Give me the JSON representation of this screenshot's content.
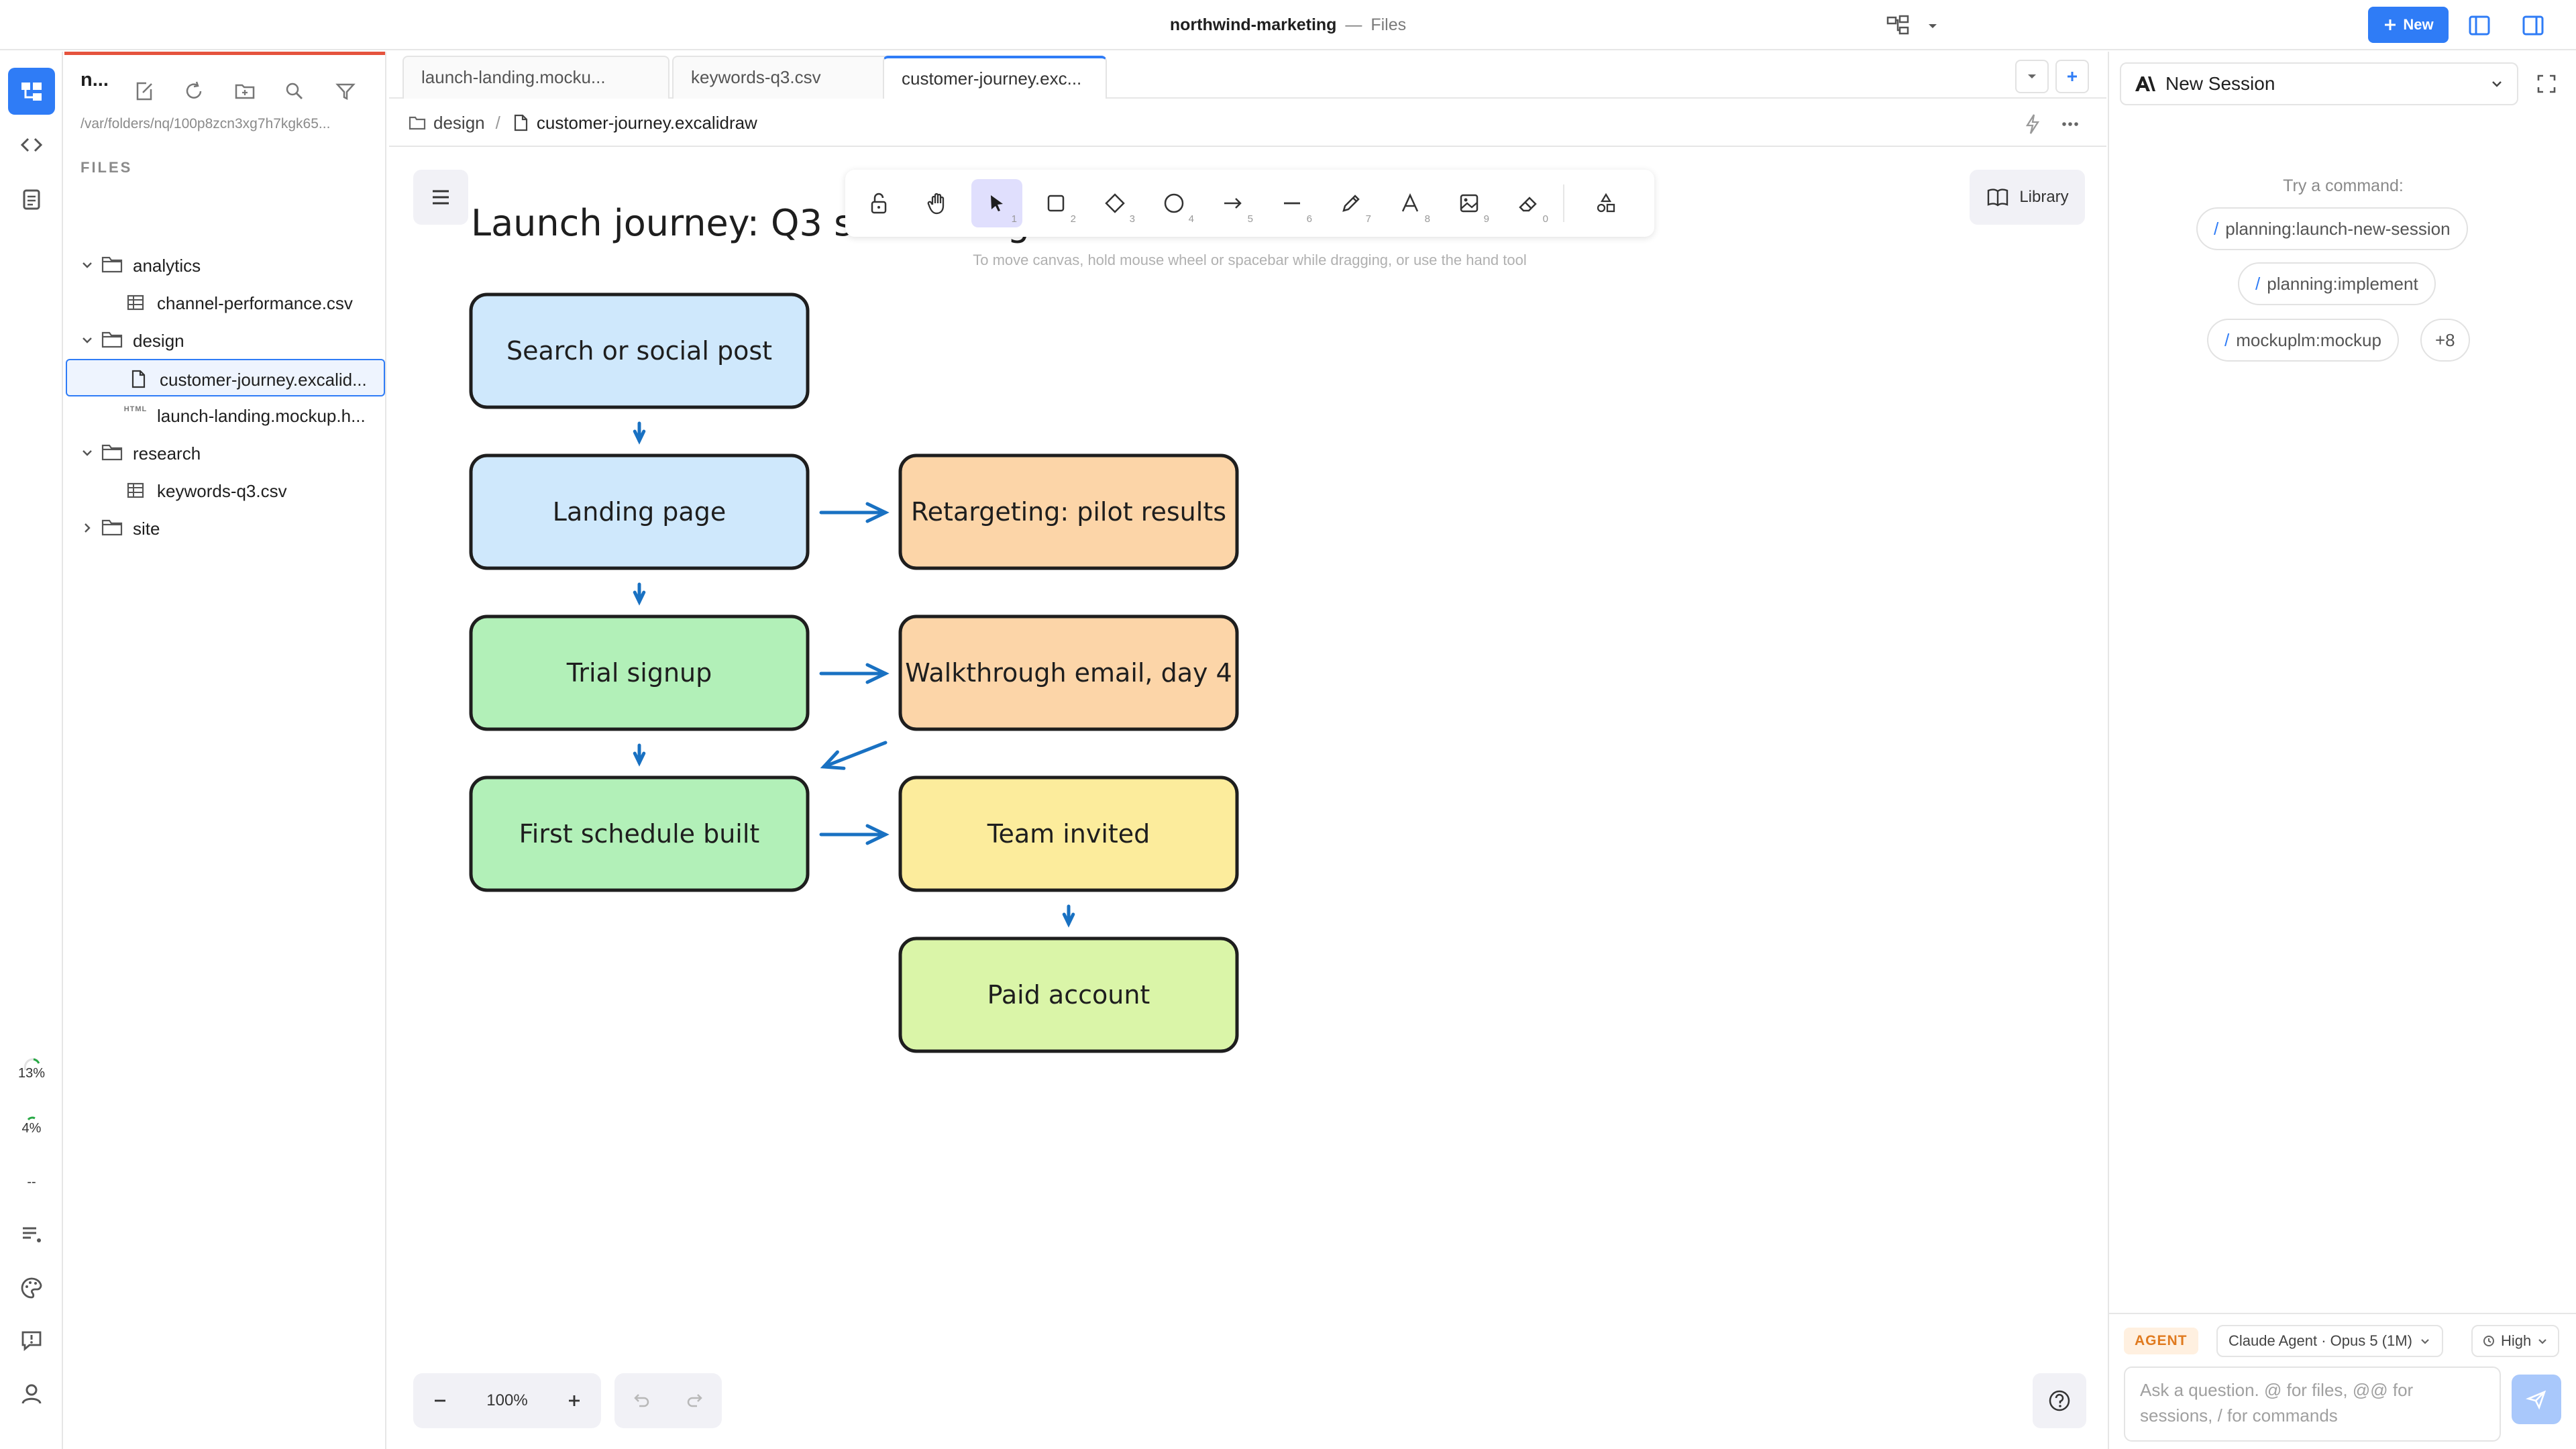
{
  "titlebar": {
    "workspace": "northwind-marketing",
    "separator": "—",
    "section": "Files",
    "new_button": "New"
  },
  "activity": {
    "items": [
      {
        "icon": "files-icon",
        "active": true
      },
      {
        "icon": "code-icon",
        "active": false
      },
      {
        "icon": "clipboard-icon",
        "active": false
      }
    ],
    "usage_1": "13%",
    "usage_2": "4%",
    "usage_3": "--"
  },
  "explorer": {
    "title": "n...",
    "path": "/var/folders/nq/100p8zcn3xg7h7kgk65...",
    "section": "FILES",
    "tree": [
      {
        "label": "analytics",
        "type": "folder",
        "expanded": true,
        "depth": 0
      },
      {
        "label": "channel-performance.csv",
        "type": "csv",
        "depth": 1
      },
      {
        "label": "design",
        "type": "folder",
        "expanded": true,
        "depth": 0
      },
      {
        "label": "customer-journey.excalid...",
        "type": "file",
        "depth": 1,
        "selected": true
      },
      {
        "label": "launch-landing.mockup.h...",
        "type": "html",
        "depth": 1
      },
      {
        "label": "research",
        "type": "folder",
        "expanded": true,
        "depth": 0
      },
      {
        "label": "keywords-q3.csv",
        "type": "csv",
        "depth": 1
      },
      {
        "label": "site",
        "type": "folder",
        "expanded": false,
        "depth": 0
      }
    ],
    "html_tag": "HTML"
  },
  "tabs": [
    {
      "label": "launch-landing.mocku...",
      "active": false
    },
    {
      "label": "keywords-q3.csv",
      "active": false
    },
    {
      "label": "customer-journey.exc...",
      "active": true
    }
  ],
  "breadcrumb": {
    "folder": "design",
    "sep": "/",
    "file": "customer-journey.excalidraw"
  },
  "canvas": {
    "library_label": "Library",
    "hint": "To move canvas, hold mouse wheel or spacebar while dragging, or use the hand tool",
    "zoom": "100%",
    "tool_numbers": [
      "1",
      "2",
      "3",
      "4",
      "5",
      "6",
      "7",
      "8",
      "9",
      "0"
    ],
    "diagram": {
      "title": "Launch journey: Q3 scheduling",
      "nodes": [
        {
          "id": "search",
          "label": "Search or social post",
          "fill": "#cfe8fc"
        },
        {
          "id": "landing",
          "label": "Landing page",
          "fill": "#cfe8fc"
        },
        {
          "id": "retarget",
          "label": "Retargeting: pilot results",
          "fill": "#fcd5a8"
        },
        {
          "id": "trial",
          "label": "Trial signup",
          "fill": "#b2f0b8"
        },
        {
          "id": "walk",
          "label": "Walkthrough email, day 4",
          "fill": "#fcd5a8"
        },
        {
          "id": "first",
          "label": "First schedule built",
          "fill": "#b2f0b8"
        },
        {
          "id": "team",
          "label": "Team invited",
          "fill": "#fcec9c"
        },
        {
          "id": "paid",
          "label": "Paid account",
          "fill": "#daf5a8"
        }
      ],
      "edges": [
        [
          "search",
          "landing"
        ],
        [
          "landing",
          "retarget"
        ],
        [
          "landing",
          "trial"
        ],
        [
          "trial",
          "walk"
        ],
        [
          "walk",
          "first"
        ],
        [
          "trial",
          "first"
        ],
        [
          "first",
          "team"
        ],
        [
          "team",
          "paid"
        ]
      ],
      "stroke": "#1e1e1e",
      "arrow_color": "#1971c2"
    }
  },
  "right_panel": {
    "session_label": "New Session",
    "try_label": "Try a command:",
    "commands": [
      "planning:launch-new-session",
      "planning:implement",
      "mockuplm:mockup"
    ],
    "more": "+8",
    "agent_badge": "AGENT",
    "model": "Claude Agent · Opus 5 (1M)",
    "effort": "High",
    "composer_placeholder": "Ask a question. @ for files, @@ for sessions, / for commands"
  },
  "colors": {
    "accent": "#2f7cf6",
    "explorer_top_line": "#e5533d",
    "tool_active": "#e0dffd"
  }
}
